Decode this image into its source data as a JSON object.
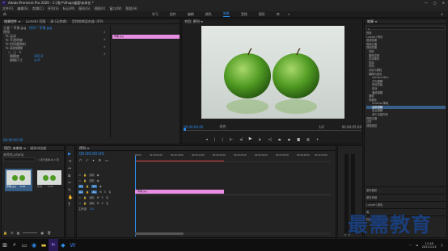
{
  "window": {
    "title": "Adobe Premiere Pro 2020 - C:\\用户\\Shop\\桌面\\未命名 *"
  },
  "menu": [
    "文件(F)",
    "编辑(E)",
    "剪辑(C)",
    "序列(S)",
    "标记(M)",
    "图形(G)",
    "视图(V)",
    "窗口(W)",
    "帮助(H)"
  ],
  "workspaces": [
    "学习",
    "组件",
    "编辑",
    "颜色",
    "效果",
    "音频",
    "图形",
    "库"
  ],
  "effect_controls": {
    "tabs": [
      "效果控件 ≡",
      "Lumetri 范围",
      "源:(无剪辑)",
      "音频剪辑混合器: 序列"
    ],
    "clip_path": "主要 * 苹果.jpg",
    "sequence": "序列 * 苹果.jpg",
    "section": "视频",
    "rows": [
      "fx 运动",
      "fx 不透明度",
      "fx 时间重映射",
      "fx 高斯模糊"
    ],
    "sub_rows": [
      "模糊度",
      "模糊尺寸"
    ],
    "blurriness": "200.0",
    "blur_dim": "水平",
    "clip_label": "苹果.jpg",
    "timecode": "00:00:00:00"
  },
  "program": {
    "title": "节目: 序列 ≡",
    "timecode_left": "00:00:00:00",
    "fit": "适合",
    "resolution": "1/2",
    "timecode_right": "00:00:05:00"
  },
  "effects_panel": {
    "title": "效果 ≡",
    "items": [
      "预设",
      "Lumetri 预设",
      "音频效果",
      "音频过渡",
      "视频效果",
      "变换",
      "图像控制",
      "实用程序",
      "扭曲",
      "时间",
      "杂色与颗粒",
      "模糊与锐化",
      "Camera Blur",
      "方向模糊",
      "钝化蒙版",
      "锐化",
      "通道模糊",
      "通道",
      "风格化",
      "Cinema 降噪",
      "高斯模糊",
      "复合模糊",
      "减少交错闪烁",
      "视频过渡",
      "过时",
      "调整图层"
    ],
    "selected": "高斯模糊",
    "footer": [
      "基本图形",
      "基本声音",
      "Lumetri 颜色",
      "库",
      "标记"
    ]
  },
  "project": {
    "tabs": [
      "项目: 未命名 ≡",
      "媒体浏览器"
    ],
    "file": "未命名.prproj",
    "count": "1 项已选择,共 2 项",
    "items": [
      {
        "label": "苹果.jpg",
        "duration": "5:00"
      },
      {
        "label": "序列",
        "duration": "5:00"
      }
    ]
  },
  "timeline": {
    "tab": "序列 ≡",
    "timecode": "00:00:00:00",
    "ruler": [
      "00:00",
      "00:00:05:00",
      "00:00:10:00",
      "00:00:15:00",
      "00:00:20:00",
      "00:00:25:00",
      "00:00:30:00",
      "00:00:35:00",
      "00:00:40:00",
      "00:00:45:00"
    ],
    "tracks": [
      "V3",
      "V2",
      "V1",
      "A1",
      "A2",
      "A3",
      "主声道"
    ],
    "clip": "苹果.jpg",
    "master_value": "0.0"
  },
  "tools": [
    "▶",
    "⇥",
    "↔",
    "⧈",
    "✂",
    "✎",
    "✋",
    "T"
  ],
  "taskbar": {
    "time": "11:28",
    "date": "2021/11/2"
  },
  "watermark": "最需教育",
  "colors": {
    "accent": "#2d8ceb",
    "clip": "#e88ee3",
    "selected": "#3a5f86"
  }
}
